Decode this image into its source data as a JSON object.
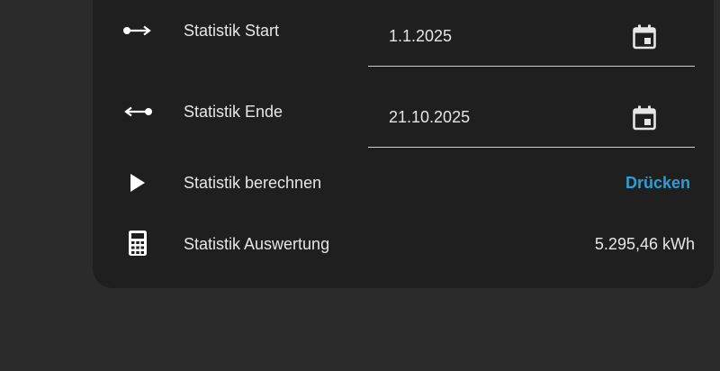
{
  "rows": {
    "start": {
      "icon": "arrow-right-dot-icon",
      "label": "Statistik Start",
      "date_value": "1.1.2025",
      "picker_icon": "calendar-icon"
    },
    "end": {
      "icon": "arrow-left-dot-icon",
      "label": "Statistik Ende",
      "date_value": "21.10.2025",
      "picker_icon": "calendar-icon"
    },
    "calculate": {
      "icon": "play-icon",
      "label": "Statistik berechnen",
      "button_label": "Drücken"
    },
    "result": {
      "icon": "calculator-icon",
      "label": "Statistik Auswertung",
      "value": "5.295,46 kWh"
    }
  },
  "colors": {
    "background": "#2b2b2b",
    "card": "#1f1f20",
    "accent": "#2a9fd6",
    "text": "#e6e6e6"
  }
}
